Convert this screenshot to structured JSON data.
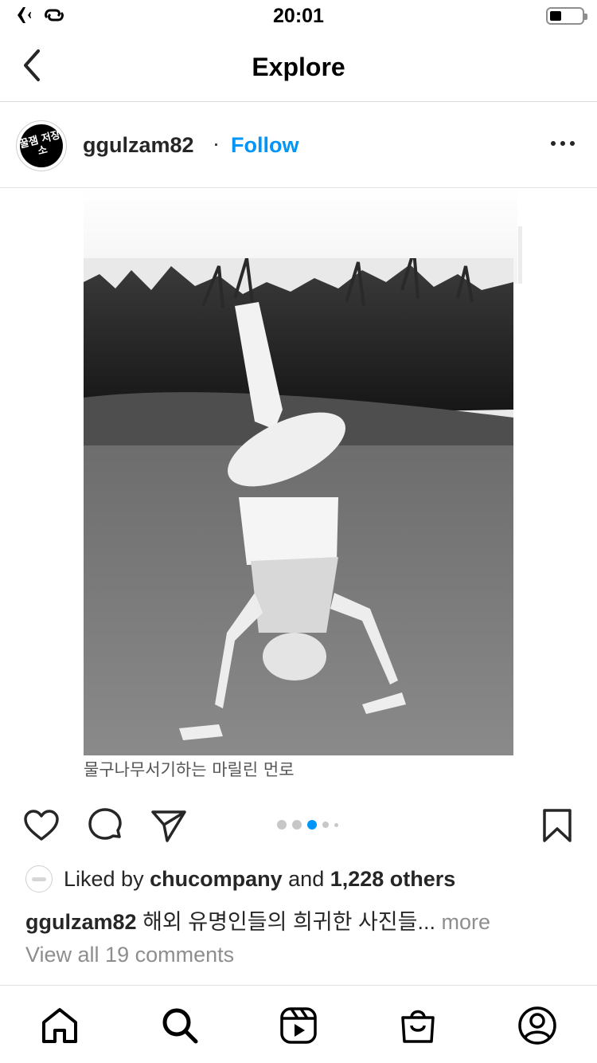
{
  "status_bar": {
    "time": "20:01",
    "icons": [
      "airplane-icon",
      "focus-icon",
      "battery-icon"
    ],
    "battery_level": 0.25
  },
  "nav": {
    "title": "Explore",
    "back_icon": "chevron-left-icon"
  },
  "post": {
    "avatar_text": "꿀잼 저장소",
    "username": "ggulzam82",
    "separator": "·",
    "follow_label": "Follow",
    "options_icon": "more-horizontal-icon",
    "image_caption": "물구나무서기하는 마릴린 먼로",
    "carousel": {
      "count": 5,
      "active_index": 2
    }
  },
  "actions": {
    "like_icon": "heart-icon",
    "comment_icon": "comment-icon",
    "share_icon": "send-icon",
    "save_icon": "bookmark-icon"
  },
  "likes": {
    "prefix": "Liked by",
    "user": "chucompany",
    "conjunction": "and",
    "count": "1,228 others"
  },
  "caption": {
    "username": "ggulzam82",
    "text": "해외 유명인들의 희귀한 사진들...",
    "more": "more"
  },
  "comments": {
    "view_all": "View all 19 comments"
  },
  "tabbar": {
    "items": [
      "home-icon",
      "search-icon",
      "reels-icon",
      "shop-icon",
      "profile-icon"
    ]
  },
  "colors": {
    "accent": "#0095f6",
    "text": "#262626",
    "muted": "#8e8e8e",
    "divider": "#dbdbdb"
  }
}
